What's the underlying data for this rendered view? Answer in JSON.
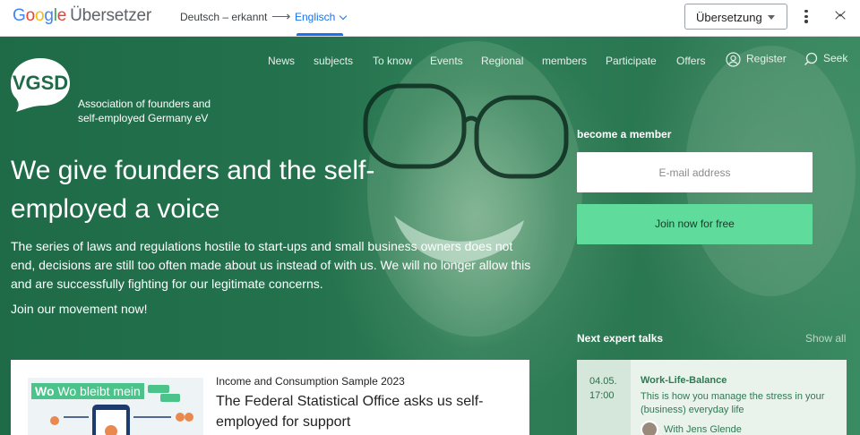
{
  "translate_bar": {
    "logo_google": "Google",
    "logo_service": "Übersetzer",
    "source_language": "Deutsch – erkannt",
    "target_language": "Englisch",
    "translation_select": "Übersetzung"
  },
  "site": {
    "logo_text": "VGSD",
    "org_name_line1": "Association of founders and",
    "org_name_line2": "self-employed Germany eV",
    "nav": [
      "News",
      "subjects",
      "To know",
      "Events",
      "Regional",
      "members",
      "Participate",
      "Offers"
    ],
    "register": "Register",
    "search": "Seek",
    "hero_title": "We give founders and the self-employed a voice",
    "hero_text": "The series of laws and regulations hostile to start-ups and small business owners does not end, decisions are still too often made about us instead of with us. We will no longer allow this and are successfully fighting for our legitimate concerns.",
    "hero_cta": "Join our movement now!",
    "become_member_label": "become a member",
    "email_placeholder": "E-mail address",
    "join_button": "Join now for free",
    "expert_talks_title": "Next expert talks",
    "show_all": "Show all",
    "article": {
      "image_caption": "Wo bleibt mein",
      "meta": "Income and Consumption Sample 2023",
      "title": "The Federal Statistical Office asks us self-employed for support"
    },
    "talk": {
      "date": "04.05.",
      "time": "17:00",
      "title": "Work-Life-Balance",
      "description": "This is how you manage the stress in your (business) everyday life",
      "speaker": "With Jens Glende"
    }
  },
  "colors": {
    "google_blue": "#4285F4",
    "google_red": "#EA4335",
    "google_yellow": "#FBBC05",
    "google_green": "#34A853",
    "hero_green": "#23714d",
    "cta_green": "#5fdc9c",
    "link_blue": "#1a73e8"
  },
  "icons": [
    "swap-arrow-icon",
    "chevron-down-icon",
    "dropdown-triangle-icon",
    "more-vert-icon",
    "collapse-icon",
    "user-icon",
    "search-icon",
    "vgsd-logo"
  ]
}
